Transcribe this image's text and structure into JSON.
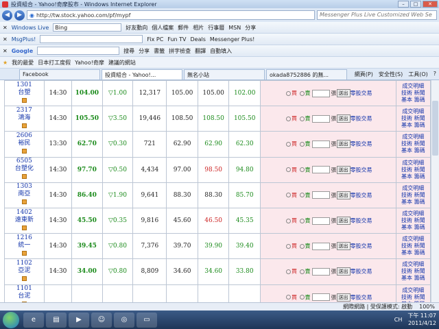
{
  "window": {
    "title": "投資組合 - Yahoo!奇摩股市 - Windows Internet Explorer"
  },
  "address": {
    "url": "http://tw.stock.yahoo.com/pf/mypf",
    "search_placeholder": "Messenger Plus Live Customized Web Se"
  },
  "toolbar1": {
    "brand": "Windows Live",
    "search_value": "Bing",
    "items": [
      "好友動向",
      "個人檔案",
      "郵件",
      "相片",
      "行事曆",
      "MSN",
      "分享"
    ]
  },
  "toolbar2": {
    "brand": "MsgPlus!",
    "items": [
      "Fix PC",
      "Fun TV",
      "Deals",
      "Messenger Plus!"
    ]
  },
  "toolbar3": {
    "brand": "Google",
    "items": [
      "搜尋",
      "分享",
      "書籤",
      "拼字檢查",
      "翻譯",
      "自動填入"
    ]
  },
  "favbar": {
    "label": "我的最愛",
    "items": [
      "日本打工度假",
      "Yahoo!奇摩",
      "建議的網站"
    ]
  },
  "tabs": [
    {
      "label": "Facebook",
      "active": false
    },
    {
      "label": "投資組合 - Yahoo!...",
      "active": true
    },
    {
      "label": "無名小站",
      "active": false
    },
    {
      "label": "okada8752886 的無...",
      "active": false
    }
  ],
  "tab_tools": [
    "網頁(P)",
    "安全性(S)",
    "工具(O)",
    "?"
  ],
  "trade": {
    "buy": "買",
    "sell": "賣",
    "unit": "張",
    "button": "送出",
    "odd_lot": "零股交易"
  },
  "links": {
    "detail": "成交明細",
    "tech": "技術",
    "news": "新聞",
    "basic": "基本",
    "chips": "籌碼"
  },
  "stocks": [
    {
      "code": "1301",
      "name": "台塑",
      "time": "14:30",
      "price": "104.00",
      "change": "▽1.00",
      "volume": "12,317",
      "prev": "105.00",
      "high": "105.00",
      "low": "102.00",
      "high_color": "blk",
      "low_color": "g"
    },
    {
      "code": "2317",
      "name": "鴻海",
      "time": "14:30",
      "price": "105.50",
      "change": "▽3.50",
      "volume": "19,446",
      "prev": "108.50",
      "high": "108.50",
      "low": "105.50",
      "high_color": "g",
      "low_color": "g"
    },
    {
      "code": "2606",
      "name": "裕民",
      "time": "13:30",
      "price": "62.70",
      "change": "▽0.30",
      "volume": "721",
      "prev": "62.90",
      "high": "62.90",
      "low": "62.30",
      "high_color": "g",
      "low_color": "g"
    },
    {
      "code": "6505",
      "name": "台塑化",
      "time": "14:30",
      "price": "97.70",
      "change": "▽0.50",
      "volume": "4,434",
      "prev": "97.00",
      "high": "98.50",
      "low": "94.80",
      "high_color": "r",
      "low_color": "g"
    },
    {
      "code": "1303",
      "name": "南亞",
      "time": "14:30",
      "price": "86.40",
      "change": "▽1.90",
      "volume": "9,641",
      "prev": "88.30",
      "high": "88.30",
      "low": "85.70",
      "high_color": "blk",
      "low_color": "g"
    },
    {
      "code": "1402",
      "name": "遠東新",
      "time": "14:30",
      "price": "45.50",
      "change": "▽0.35",
      "volume": "9,816",
      "prev": "45.60",
      "high": "46.50",
      "low": "45.35",
      "high_color": "r",
      "low_color": "g"
    },
    {
      "code": "1216",
      "name": "統一",
      "time": "14:30",
      "price": "39.45",
      "change": "▽0.80",
      "volume": "7,376",
      "prev": "39.70",
      "high": "39.90",
      "low": "39.40",
      "high_color": "g",
      "low_color": "g"
    },
    {
      "code": "1102",
      "name": "亞泥",
      "time": "14:30",
      "price": "34.00",
      "change": "▽0.80",
      "volume": "8,809",
      "prev": "34.60",
      "high": "34.60",
      "low": "33.80",
      "high_color": "g",
      "low_color": "g"
    },
    {
      "code": "1101",
      "name": "台泥",
      "time": "",
      "price": "",
      "change": "",
      "volume": "",
      "prev": "",
      "high": "",
      "low": "",
      "high_color": "g",
      "low_color": "g"
    }
  ],
  "status": {
    "zone": "網際網路 | 受保護模式: 啟動",
    "zoom": "100%"
  },
  "taskbar": {
    "lang": "CH",
    "time": "下午 11:07",
    "date": "2011/4/12"
  }
}
